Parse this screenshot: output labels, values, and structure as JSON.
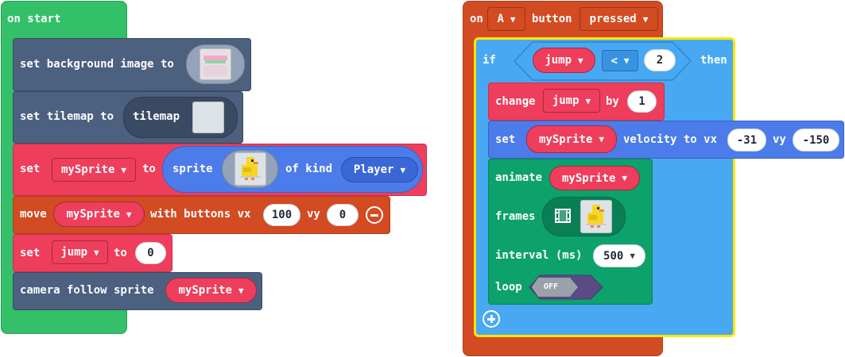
{
  "on_start": {
    "title": "on start",
    "set_background": {
      "label": "set background image to"
    },
    "set_tilemap": {
      "label": "set tilemap to",
      "block": "tilemap"
    },
    "set_sprite": {
      "set": "set",
      "variable": "mySprite",
      "to": "to",
      "sprite": "sprite",
      "of_kind": "of kind",
      "kind": "Player"
    },
    "move": {
      "label": "move",
      "variable": "mySprite",
      "with_buttons_vx": "with buttons vx",
      "vx": "100",
      "vy_label": "vy",
      "vy": "0"
    },
    "set_jump": {
      "set": "set",
      "variable": "jump",
      "to": "to",
      "value": "0"
    },
    "camera": {
      "label": "camera follow sprite",
      "variable": "mySprite"
    }
  },
  "on_button": {
    "on": "on",
    "button": "A",
    "button_label": "button",
    "event": "pressed",
    "if_block": {
      "if": "if",
      "variable": "jump",
      "operator": "<",
      "value": "2",
      "then": "then",
      "change": {
        "label": "change",
        "variable": "jump",
        "by": "by",
        "value": "1"
      },
      "velocity": {
        "set": "set",
        "variable": "mySprite",
        "velocity_to_vx": "velocity to vx",
        "vx": "-31",
        "vy_label": "vy",
        "vy": "-150"
      },
      "animate": {
        "label": "animate",
        "variable": "mySprite",
        "frames": "frames",
        "interval_label": "interval (ms)",
        "interval": "500",
        "loop_label": "loop",
        "loop_value": "OFF"
      }
    }
  },
  "colors": {
    "events": "#33c069",
    "scene": "#4c6080",
    "variables": "#ee3e5c",
    "controller": "#d34b22",
    "sprites": "#4c7bea",
    "animation": "#0da16c",
    "logic": "#48a9f2",
    "highlight": "#ffe600"
  },
  "icons": {
    "dropdown": "caret-down-icon",
    "remove": "minus-circle-icon",
    "add": "plus-circle-icon",
    "frames": "film-icon"
  }
}
